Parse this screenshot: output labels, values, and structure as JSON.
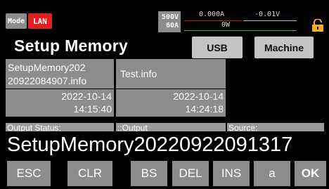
{
  "status": {
    "mode_label": "Mode",
    "interface_label": "LAN",
    "rated_voltage": "500V",
    "rated_current": "60A",
    "current_reading": "0.000A",
    "voltage_reading": "-0.01V",
    "power_reading": "0W",
    "colors": {
      "lan": "#e02020",
      "lock": "#f0b020",
      "current_line": "#c02020",
      "voltage_line": "#d8c020",
      "power_line": "#20c050"
    }
  },
  "header": {
    "title": "Setup Memory",
    "usb_label": "USB",
    "machine_label": "Machine"
  },
  "files": [
    {
      "name_line1": "SetupMemory202",
      "name_line2": "20922084907.info",
      "date": "2022-10-14",
      "time": "14:15:40"
    },
    {
      "name_line1": "Test.info",
      "name_line2": "",
      "date": "2022-10-14",
      "time": "14:24:18"
    }
  ],
  "row3": {
    "col1": "Output Status:",
    "col2": "::Output",
    "col3": "Source:"
  },
  "entry": {
    "value": "SetupMemory20220922091317"
  },
  "keyboard": {
    "esc": "ESC",
    "clr": "CLR",
    "bs": "BS",
    "del": "DEL",
    "ins": "INS",
    "case": "a",
    "ok": "OK"
  }
}
